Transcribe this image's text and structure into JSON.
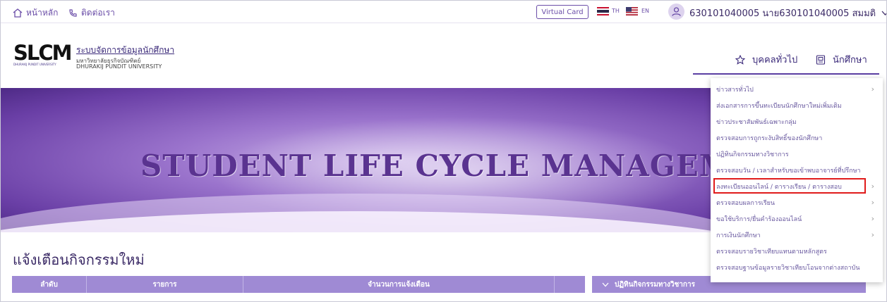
{
  "topbar": {
    "home_label": "หน้าหลัก",
    "contact_label": "ติดต่อเรา",
    "virtual_card": "Virtual Card",
    "lang_th": "TH",
    "lang_en": "EN",
    "user_name": "630101040005 นาย630101040005 สมมติ"
  },
  "header": {
    "logo_text": "SLCM",
    "logo_sub": "DHURAKIJ PUNDIT UNIVERSITY",
    "system_title": "ระบบจัดการข้อมูลนักศึกษา",
    "university_th": "มหาวิทยาลัยธุรกิจบัณฑิตย์",
    "university_en": "DHURAKIJ PUNDIT UNIVERSITY",
    "nav_general": "บุคคลทั่วไป",
    "nav_student": "นักศึกษา"
  },
  "banner": {
    "title": "STUDENT LIFE CYCLE MANAGEME"
  },
  "notice": {
    "title": "แจ้งเตือนกิจกรรมใหม่",
    "columns": [
      "ลำดับ",
      "รายการ",
      "จำนวนการแจ้งเตือน"
    ],
    "panel_title": "ปฏิทินกิจกรรมทางวิชาการ"
  },
  "menu": {
    "items": [
      {
        "label": "ข่าวสารทั่วไป",
        "has_sub": true
      },
      {
        "label": "ส่งเอกสารการขึ้นทะเบียนนักศึกษาใหม่เพิ่มเติม",
        "has_sub": false
      },
      {
        "label": "ข่าวประชาสัมพันธ์เฉพาะกลุ่ม",
        "has_sub": false
      },
      {
        "label": "ตรวจสอบการถูกระงับสิทธิ์ของนักศึกษา",
        "has_sub": false
      },
      {
        "label": "ปฏิทินกิจกรรมทางวิชาการ",
        "has_sub": false
      },
      {
        "label": "ตรวจสอบวัน / เวลาสำหรับขอเข้าพบอาจารย์ที่ปรึกษา",
        "has_sub": false
      },
      {
        "label": "ลงทะเบียนออนไลน์ / ตารางเรียน / ตารางสอบ",
        "has_sub": true
      },
      {
        "label": "ตรวจสอบผลการเรียน",
        "has_sub": true
      },
      {
        "label": "ขอใช้บริการ/ยื่นคำร้องออนไลน์",
        "has_sub": true
      },
      {
        "label": "การเงินนักศึกษา",
        "has_sub": true
      },
      {
        "label": "ตรวจสอบรายวิชาเทียบแทนตามหลักสูตร",
        "has_sub": false
      },
      {
        "label": "ตรวจสอบฐานข้อมูลรายวิชาเทียบโอนจากต่างสถาบัน",
        "has_sub": false
      }
    ],
    "highlighted_index": 6
  },
  "colors": {
    "brand": "#6b4ea8",
    "table_header": "#9f8ad4",
    "highlight": "#e01b1b"
  }
}
